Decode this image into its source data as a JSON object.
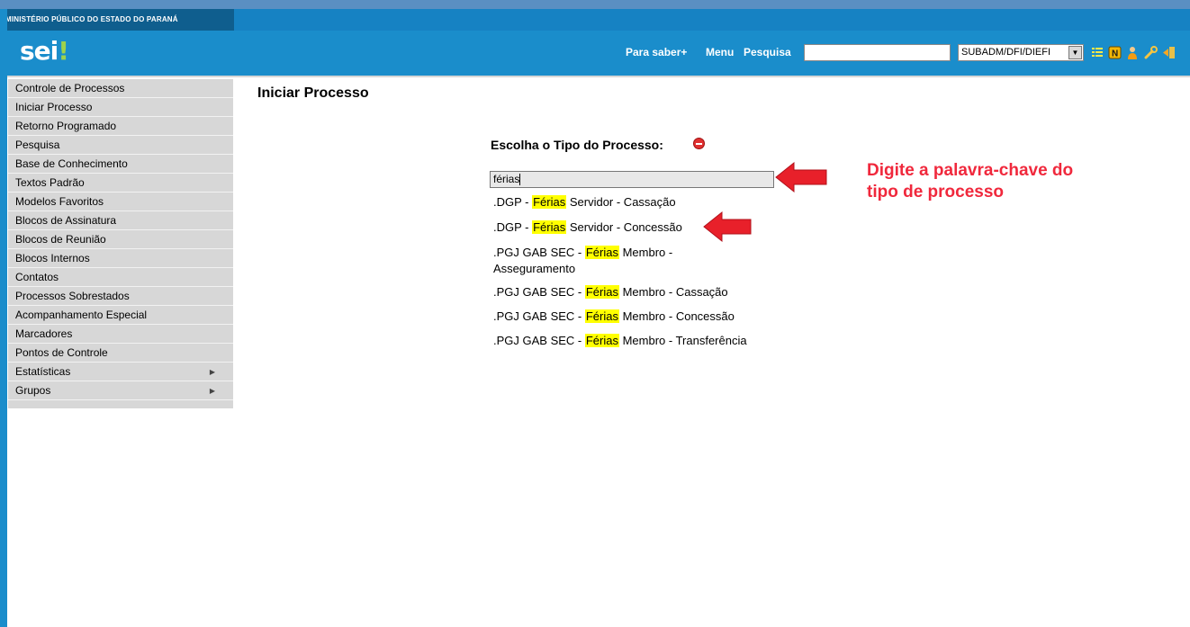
{
  "org": {
    "name": "MINISTÉRIO PÚBLICO DO ESTADO DO PARANÁ"
  },
  "app": {
    "logo_text": "sei",
    "logo_accent": "!"
  },
  "header": {
    "links": [
      "Para saber+",
      "Menu",
      "Pesquisa"
    ],
    "search_value": "",
    "unit_selected": "SUBADM/DFI/DIEFI",
    "icons": [
      "list-icon",
      "notes-icon",
      "user-icon",
      "wrench-icon",
      "exit-icon"
    ]
  },
  "sidebar": {
    "items": [
      {
        "label": "Controle de Processos",
        "submenu": false
      },
      {
        "label": "Iniciar Processo",
        "submenu": false
      },
      {
        "label": "Retorno Programado",
        "submenu": false
      },
      {
        "label": "Pesquisa",
        "submenu": false
      },
      {
        "label": "Base de Conhecimento",
        "submenu": false
      },
      {
        "label": "Textos Padrão",
        "submenu": false
      },
      {
        "label": "Modelos Favoritos",
        "submenu": false
      },
      {
        "label": "Blocos de Assinatura",
        "submenu": false
      },
      {
        "label": "Blocos de Reunião",
        "submenu": false
      },
      {
        "label": "Blocos Internos",
        "submenu": false
      },
      {
        "label": "Contatos",
        "submenu": false
      },
      {
        "label": "Processos Sobrestados",
        "submenu": false
      },
      {
        "label": "Acompanhamento Especial",
        "submenu": false
      },
      {
        "label": "Marcadores",
        "submenu": false
      },
      {
        "label": "Pontos de Controle",
        "submenu": false
      },
      {
        "label": "Estatísticas",
        "submenu": true
      },
      {
        "label": "Grupos",
        "submenu": true
      }
    ]
  },
  "main": {
    "title": "Iniciar Processo",
    "choose_label": "Escolha o Tipo do Processo:",
    "filter_value": "férias",
    "results": [
      {
        "pre": ".DGP - ",
        "hl": "Férias",
        "post": " Servidor - Cassação"
      },
      {
        "pre": ".DGP - ",
        "hl": "Férias",
        "post": " Servidor - Concessão"
      },
      {
        "pre": ".PGJ GAB SEC - ",
        "hl": "Férias",
        "post": " Membro -",
        "line2": "Asseguramento"
      },
      {
        "pre": ".PGJ GAB SEC - ",
        "hl": "Férias",
        "post": " Membro - Cassação"
      },
      {
        "pre": ".PGJ GAB SEC - ",
        "hl": "Férias",
        "post": " Membro - Concessão"
      },
      {
        "pre": ".PGJ GAB SEC - ",
        "hl": "Férias",
        "post": " Membro - Transferência"
      }
    ]
  },
  "annotation": {
    "line1": "Digite a palavra-chave do",
    "line2": "tipo de processo",
    "color": "#f0283c"
  },
  "colors": {
    "header": "#1a8dcb",
    "org_tab": "#0f5e8e",
    "sidebar": "#d7d7d7",
    "highlight": "#ffff00"
  }
}
